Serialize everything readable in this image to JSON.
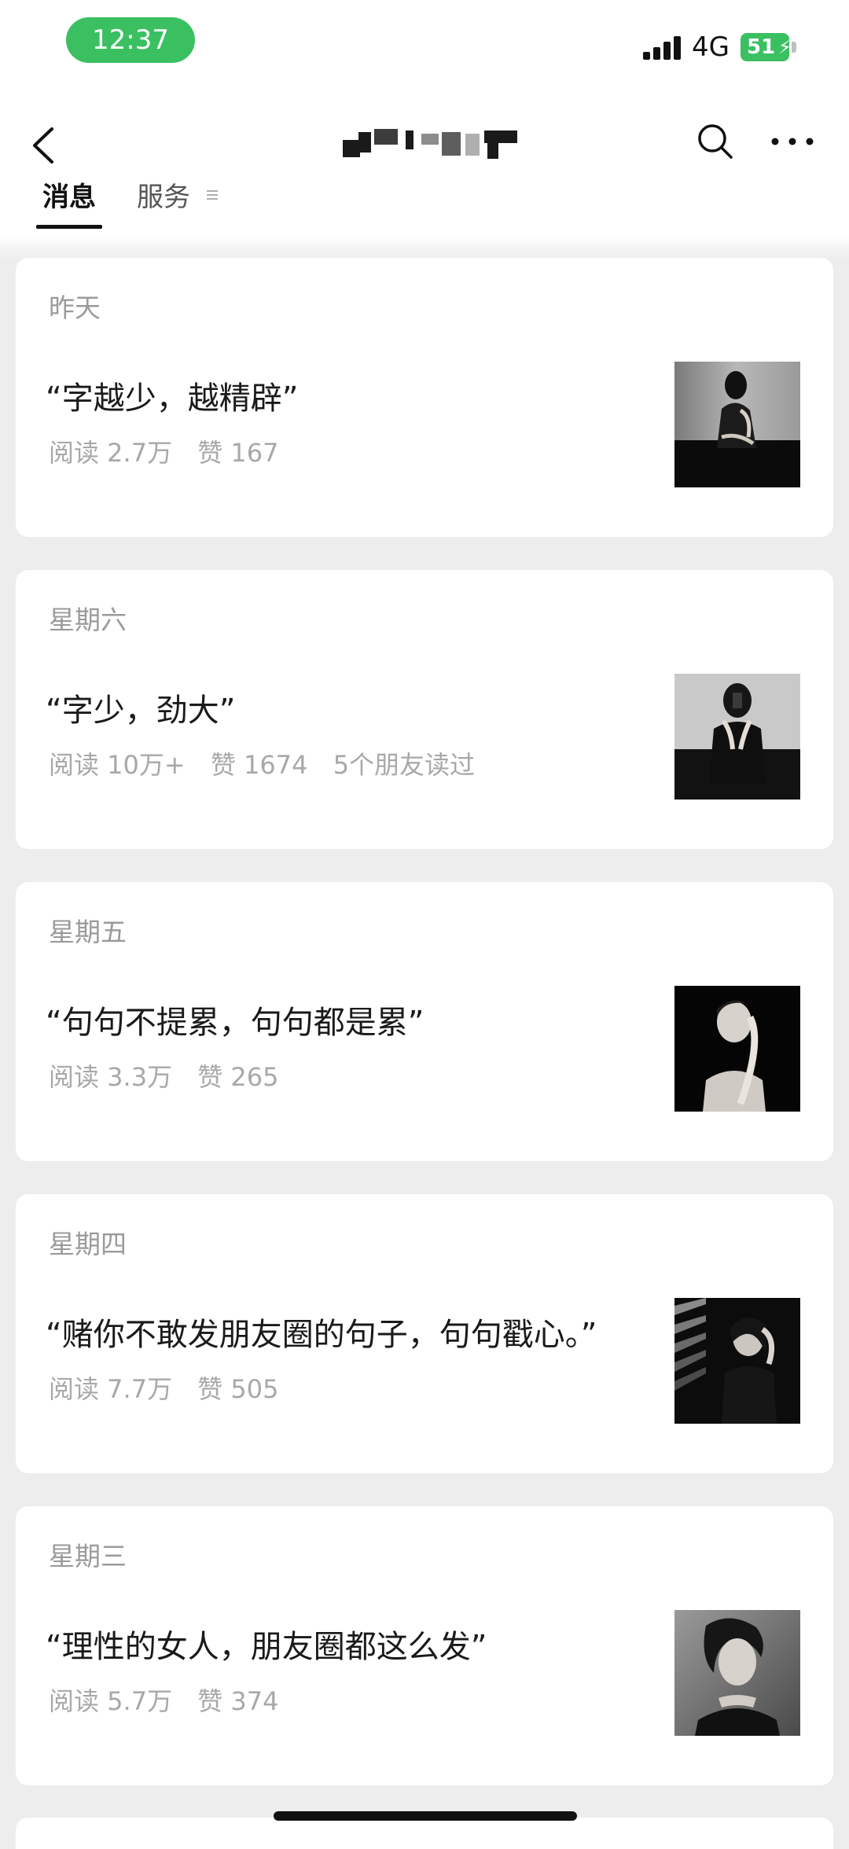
{
  "status_bar": {
    "time": "12:37",
    "network": "4G",
    "battery": "51",
    "accent_color": "#3ac061"
  },
  "nav": {
    "back_icon": "chevron-left-icon",
    "search_icon": "search-icon",
    "more_icon": "more-dots-icon",
    "tabs": [
      {
        "label": "消息",
        "active": true
      },
      {
        "label": "服务",
        "active": false,
        "icon": "menu-lines-icon"
      }
    ]
  },
  "articles": [
    {
      "date": "昨天",
      "title": "“字越少，越精辟”",
      "reads": "阅读 2.7万",
      "likes": "赞 167",
      "friends": ""
    },
    {
      "date": "星期六",
      "title": "“字少，劲大”",
      "reads": "阅读 10万+",
      "likes": "赞 1674",
      "friends": "5个朋友读过"
    },
    {
      "date": "星期五",
      "title": "“句句不提累，句句都是累”",
      "reads": "阅读 3.3万",
      "likes": "赞 265",
      "friends": ""
    },
    {
      "date": "星期四",
      "title": "“赌你不敢发朋友圈的句子，句句戳心。”",
      "reads": "阅读 7.7万",
      "likes": "赞 505",
      "friends": ""
    },
    {
      "date": "星期三",
      "title": "“理性的女人，朋友圈都这么发”",
      "reads": "阅读 5.7万",
      "likes": "赞 374",
      "friends": ""
    }
  ]
}
